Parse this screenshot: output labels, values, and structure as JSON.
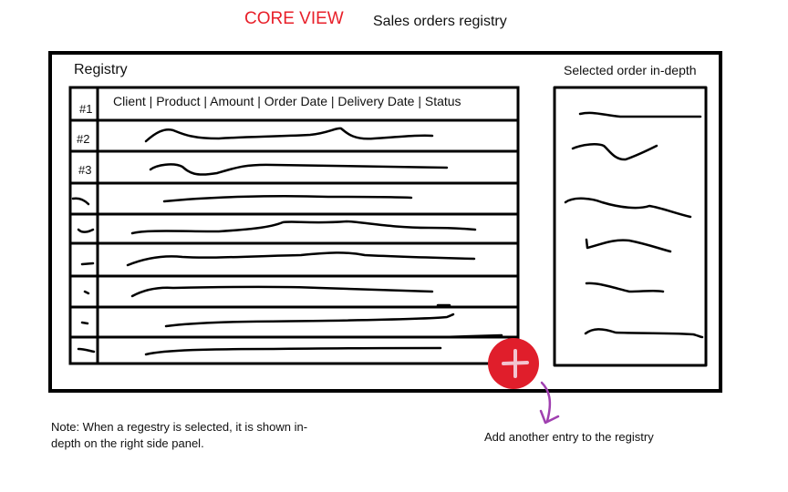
{
  "header": {
    "title": "CORE VIEW",
    "subtitle": "Sales orders registry"
  },
  "registry": {
    "label": "Registry",
    "columns_text": "Client | Product | Amount | Order Date | Delivery Date | Status",
    "row_numbers": [
      "#1",
      "#2",
      "#3"
    ]
  },
  "detail_panel": {
    "label": "Selected order in-depth"
  },
  "add_button": {
    "icon": "plus-icon",
    "label": "Add another entry to the registry"
  },
  "note": "Note: When a regestry is selected, it is shown in-depth on the right side panel.",
  "colors": {
    "accent_red": "#e01e2b",
    "arrow_purple": "#a040b0",
    "ink": "#000000"
  }
}
